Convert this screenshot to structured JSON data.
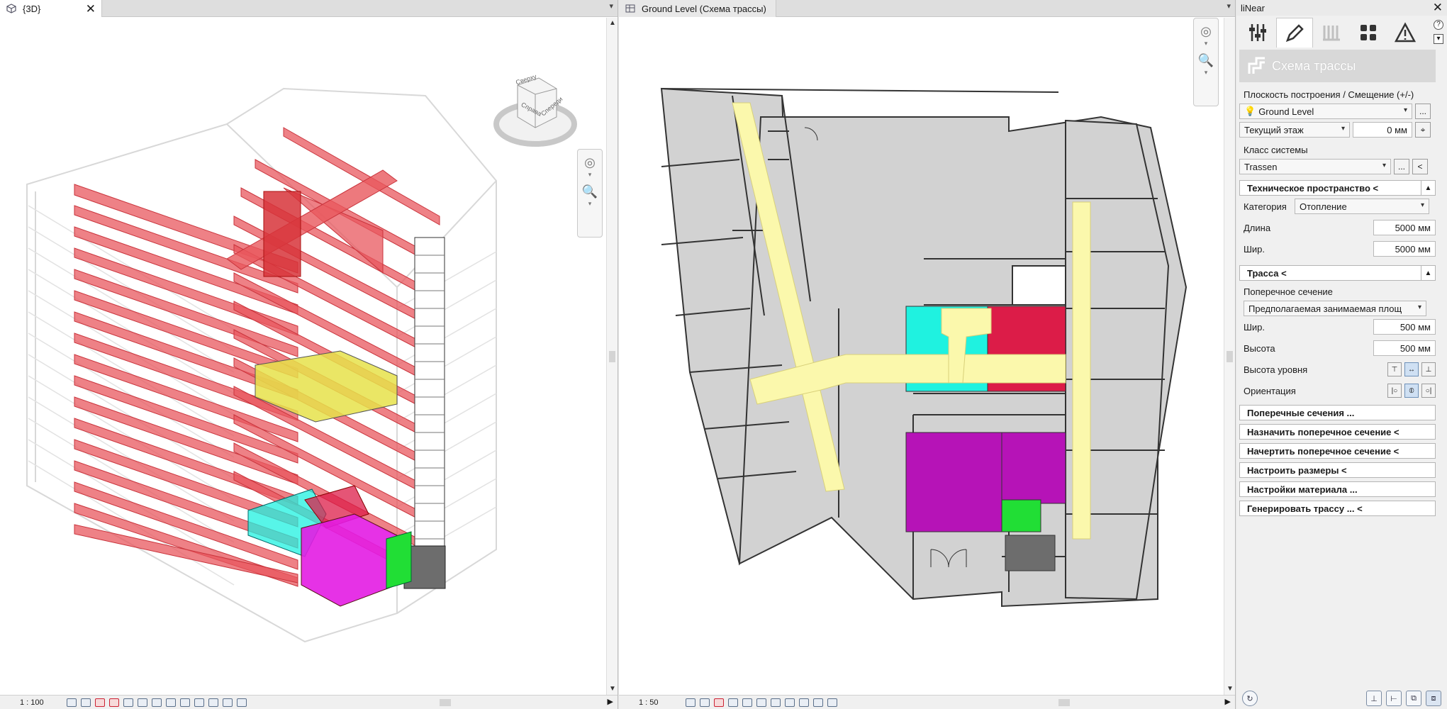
{
  "left_view": {
    "tab_label": "{3D}",
    "close_glyph": "✕",
    "menu_glyph": "▾",
    "scale": "1 : 100",
    "viewcube_faces": [
      "Справа",
      "Спереди",
      "Сверху"
    ]
  },
  "right_view": {
    "tab_label": "Ground Level (Схема трассы)",
    "menu_glyph": "▾",
    "scale": "1 : 50"
  },
  "panel": {
    "title": "liNear",
    "close_glyph": "✕",
    "header_title": "Схема трассы",
    "plane_label": "Плоскость построения / Смещение (+/-)",
    "level_value": "Ground Level",
    "floor_value": "Текущий этаж",
    "offset_value": "0 мм",
    "system_class_label": "Класс системы",
    "system_class_value": "Trassen",
    "tech_space_section": "Техническое пространство <",
    "category_label": "Категория",
    "category_value": "Отопление",
    "length_label": "Длина",
    "length_value": "5000 мм",
    "width_label": "Шир.",
    "width_value": "5000 мм",
    "route_section": "Трасса <",
    "cross_section_label": "Поперечное сечение",
    "cross_section_value": "Предполагаемая занимаемая площ",
    "route_width_label": "Шир.",
    "route_width_value": "500 мм",
    "height_label": "Высота",
    "height_value": "500 мм",
    "level_height_label": "Высота уровня",
    "orientation_label": "Ориентация",
    "btn_cross_sections": "Поперечные сечения ...",
    "btn_assign": "Назначить поперечное сечение <",
    "btn_draw": "Начертить поперечное сечение <",
    "btn_dimensions": "Настроить размеры <",
    "btn_material": "Настройки материала ...",
    "btn_generate": "Генерировать трассу ... <",
    "ellipsis": "...",
    "chev_left": "<"
  },
  "colors": {
    "pipe_red": "#e8575d",
    "route_yellow": "#fbf8ac",
    "room_cyan": "#1ff2e0",
    "room_red": "#dc1c48",
    "room_magenta": "#b613b7",
    "room_green": "#21de35",
    "wall_gray": "#d2d2d2",
    "dark_gray": "#6d6d6d"
  }
}
